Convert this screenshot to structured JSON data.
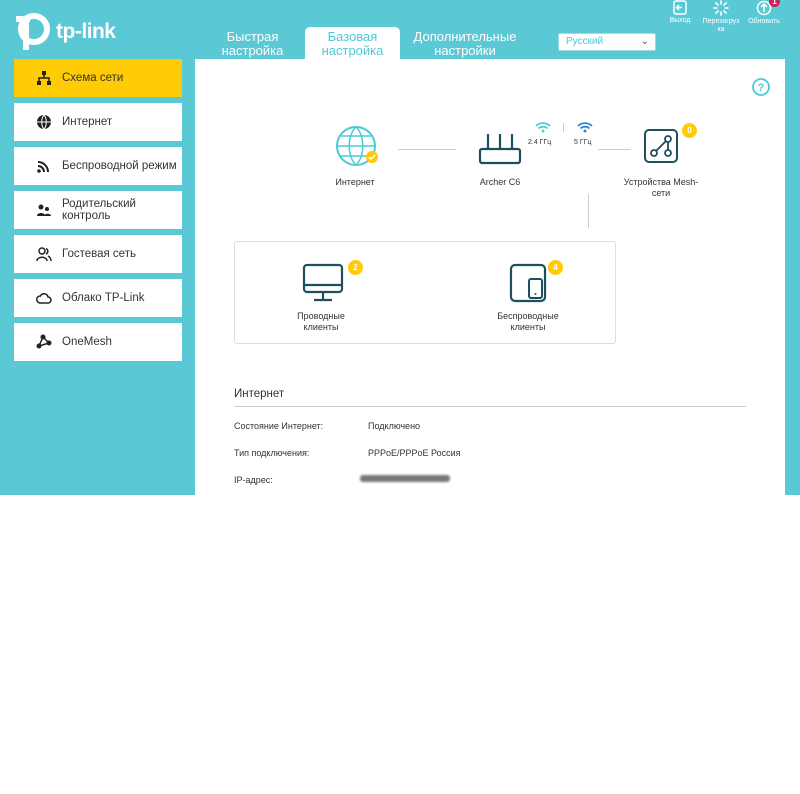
{
  "header": {
    "logo_text": "tp-link",
    "tabs": [
      {
        "label": "Быстрая настройка",
        "active": false
      },
      {
        "label": "Базовая настройка",
        "active": true
      },
      {
        "label": "Дополнительные настройки",
        "active": false
      }
    ],
    "language": {
      "selected": "Русский"
    },
    "buttons": {
      "logout": "Выход",
      "reboot": "Перезагрузка",
      "update": "Обновить",
      "update_badge": "1"
    }
  },
  "sidebar": {
    "items": [
      {
        "label": "Схема сети",
        "icon": "network-map-icon",
        "active": true
      },
      {
        "label": "Интернет",
        "icon": "globe-icon",
        "active": false
      },
      {
        "label": "Беспроводной режим",
        "icon": "wireless-icon",
        "active": false
      },
      {
        "label": "Родительский контроль",
        "icon": "parental-icon",
        "active": false
      },
      {
        "label": "Гостевая сеть",
        "icon": "guest-icon",
        "active": false
      },
      {
        "label": "Облако TP-Link",
        "icon": "cloud-icon",
        "active": false
      },
      {
        "label": "OneMesh",
        "icon": "onemesh-icon",
        "active": false
      }
    ]
  },
  "network_map": {
    "internet_label": "Интернет",
    "router_label": "Archer C6",
    "band_24": "2.4 ГГц",
    "band_5": "5 ГГц",
    "mesh_label": "Устройства Mesh-сети",
    "mesh_count": "0",
    "wired_label": "Проводные клиенты",
    "wired_count": "2",
    "wireless_label": "Беспроводные клиенты",
    "wireless_count": "4"
  },
  "internet_section": {
    "title": "Интернет",
    "rows": [
      {
        "label": "Состояние Интернет:",
        "value": "Подключено"
      },
      {
        "label": "Тип подключения:",
        "value": "PPPoE/PPPoE Россия"
      },
      {
        "label": "IP-адрес:",
        "value": ""
      }
    ]
  },
  "colors": {
    "teal": "#5bc8d6",
    "accent_yellow": "#ffcb05",
    "icon_dark": "#1e4f5c",
    "badge_red": "#d0215e"
  }
}
